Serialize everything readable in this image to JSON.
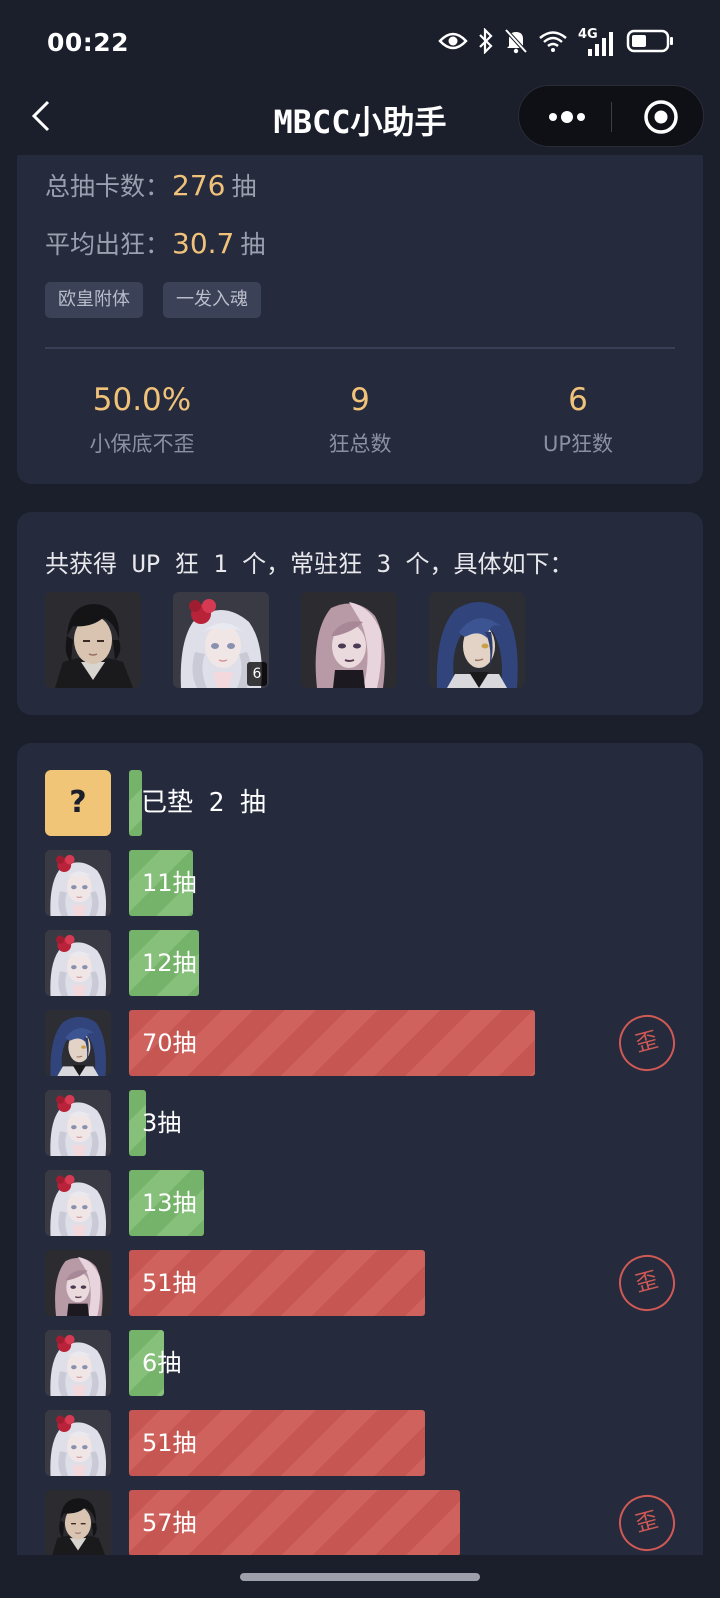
{
  "status_bar": {
    "time": "00:22",
    "icons": [
      "eye-icon",
      "bluetooth-icon",
      "mute-icon",
      "wifi-icon",
      "signal-4g-icon",
      "battery-icon"
    ],
    "network_label": "4G",
    "battery_level": 0.45
  },
  "nav": {
    "title": "MBCC小助手"
  },
  "summary": {
    "total_pulls_label": "总抽卡数：",
    "total_pulls_value": "276",
    "total_pulls_unit": "抽",
    "avg_label": "平均出狂：",
    "avg_value": "30.7",
    "avg_unit": "抽",
    "tags": [
      "欧皇附体",
      "一发入魂"
    ],
    "stats": [
      {
        "value": "50.0%",
        "label": "小保底不歪"
      },
      {
        "value": "9",
        "label": "狂总数"
      },
      {
        "value": "6",
        "label": "UP狂数"
      }
    ]
  },
  "gained": {
    "text": "共获得 UP 狂 1 个，常驻狂 3 个，具体如下：",
    "characters": [
      {
        "name": "dark-haired-male",
        "count": null
      },
      {
        "name": "white-haired-female",
        "count": "6"
      },
      {
        "name": "pink-haired-female",
        "count": null
      },
      {
        "name": "blue-haired-male",
        "count": null
      }
    ]
  },
  "history": {
    "pending": {
      "mark": "?",
      "label": "已垫 2 抽",
      "pulls": 2
    },
    "rows": [
      {
        "char": "white-haired-female",
        "label": "11抽",
        "pulls": 11,
        "type": "good"
      },
      {
        "char": "white-haired-female",
        "label": "12抽",
        "pulls": 12,
        "type": "good"
      },
      {
        "char": "blue-haired-male",
        "label": "70抽",
        "pulls": 70,
        "type": "bad",
        "badge": "歪"
      },
      {
        "char": "white-haired-female",
        "label": "3抽",
        "pulls": 3,
        "type": "good"
      },
      {
        "char": "white-haired-female",
        "label": "13抽",
        "pulls": 13,
        "type": "good"
      },
      {
        "char": "pink-haired-female",
        "label": "51抽",
        "pulls": 51,
        "type": "bad",
        "badge": "歪"
      },
      {
        "char": "white-haired-female",
        "label": "6抽",
        "pulls": 6,
        "type": "good"
      },
      {
        "char": "white-haired-female",
        "label": "51抽",
        "pulls": 51,
        "type": "bad"
      },
      {
        "char": "dark-haired-male",
        "label": "57抽",
        "pulls": 57,
        "type": "bad",
        "badge": "歪"
      }
    ]
  }
}
